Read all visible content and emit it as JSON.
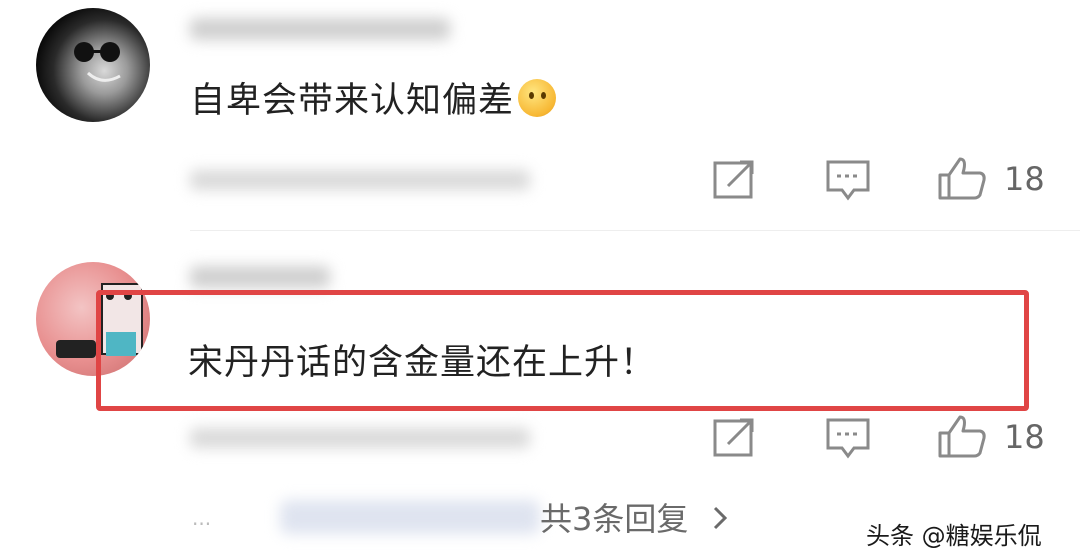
{
  "comments": [
    {
      "text": "自卑会带来认知偏差",
      "emoji_icon": "thinking-face-emoji",
      "like_count": "18"
    },
    {
      "text": "宋丹丹话的含金量还在上升！",
      "like_count": "18",
      "replies_label": "共3条回复"
    }
  ],
  "icons": [
    "share-icon",
    "comment-icon",
    "thumbs-up-icon",
    "chevron-right-icon"
  ],
  "watermark": "头条 @糖娱乐侃",
  "colors": {
    "highlight": "#e04545",
    "icon": "#8a8a8a",
    "text": "#222222"
  }
}
